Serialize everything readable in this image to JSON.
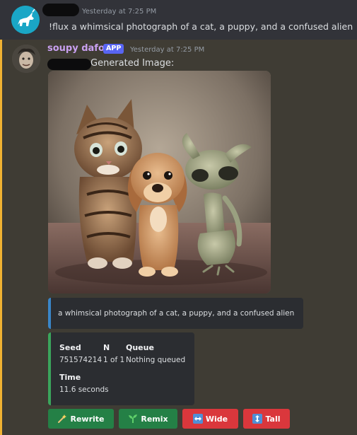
{
  "message1": {
    "timestamp": "Yesterday at 7:25 PM",
    "content": "!flux a whimsical photograph of a cat, a puppy, and a confused alien"
  },
  "message2": {
    "username": "soupy dafoe",
    "badge": "APP",
    "timestamp": "Yesterday at 7:25 PM",
    "label": "Generated Image:",
    "image_alt": "a whimsical photograph of a cat, a puppy, and a confused alien"
  },
  "prompt_embed": {
    "text": "a whimsical photograph of a cat, a puppy, and a confused alien"
  },
  "info_embed": {
    "seed_label": "Seed",
    "seed_value": "751574214",
    "n_label": "N",
    "n_value": "1 of 1",
    "queue_label": "Queue",
    "queue_value": "Nothing queued",
    "time_label": "Time",
    "time_value": "11.6 seconds"
  },
  "buttons": [
    {
      "label": "Rewrite",
      "icon": "magic-wand-icon",
      "color": "#248046"
    },
    {
      "label": "Remix",
      "icon": "seedling-icon",
      "color": "#248046"
    },
    {
      "label": "Wide",
      "icon": "left-right-arrow-icon",
      "color": "#da373c"
    },
    {
      "label": "Tall",
      "icon": "up-down-arrow-icon",
      "color": "#da373c"
    }
  ],
  "colors": {
    "background": "#323339",
    "highlight_bg": "#3f3c34",
    "highlight_border": "#f0b232",
    "username": "#c9a0f0",
    "app_badge": "#5865f2",
    "embed_bg": "#2b2d31",
    "prompt_border": "#3a86c8",
    "info_border": "#3ba55c"
  }
}
